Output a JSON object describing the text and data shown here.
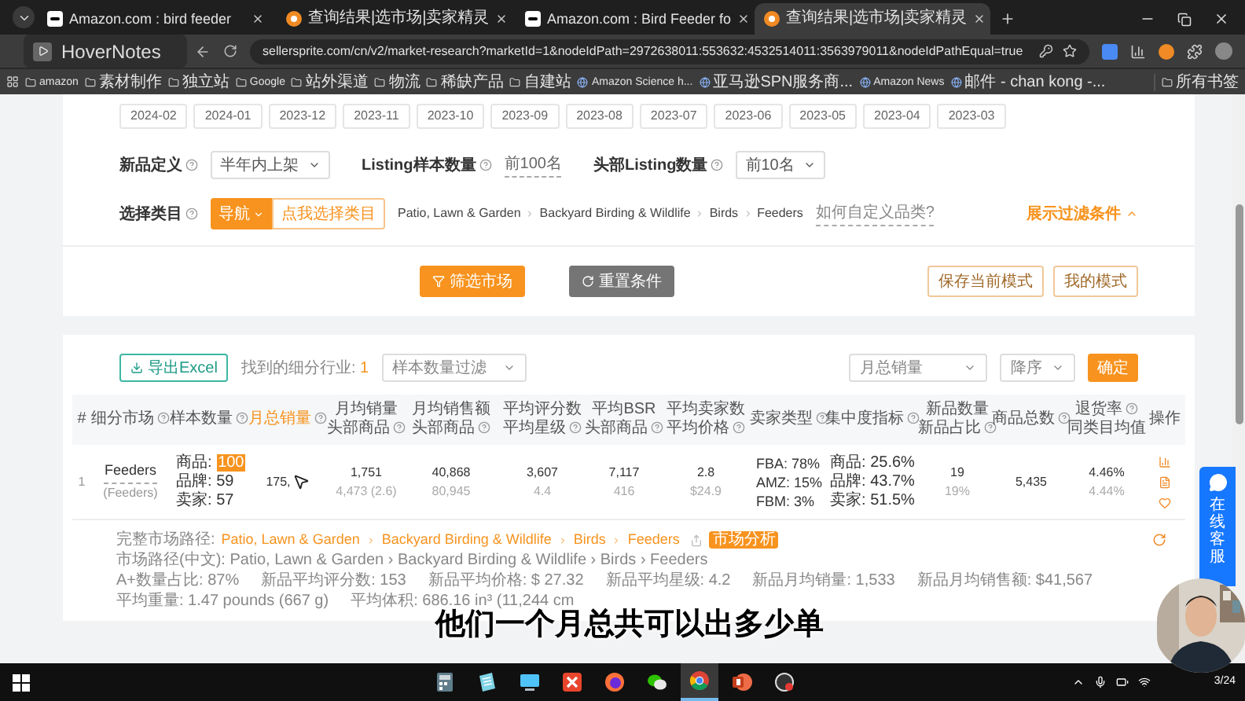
{
  "browser": {
    "tabs": [
      {
        "title": "Amazon.com : bird feeder",
        "kind": "amazon",
        "selected": false
      },
      {
        "title": "查询结果|选市场|卖家精灵",
        "kind": "sprite",
        "selected": false
      },
      {
        "title": "Amazon.com : Bird Feeder fo",
        "kind": "amazon",
        "selected": false
      },
      {
        "title": "查询结果|选市场|卖家精灵",
        "kind": "sprite",
        "selected": true
      }
    ],
    "url": "sellersprite.com/cn/v2/market-research?marketId=1&nodeIdPath=2972638011:553632:4532514011:3563979011&nodeIdPathEqual=true",
    "bookmarks": [
      {
        "label": "amazon",
        "kind": "folder"
      },
      {
        "label": "素材制作",
        "kind": "folder"
      },
      {
        "label": "独立站",
        "kind": "folder"
      },
      {
        "label": "Google",
        "kind": "folder"
      },
      {
        "label": "站外渠道",
        "kind": "folder"
      },
      {
        "label": "物流",
        "kind": "folder"
      },
      {
        "label": "稀缺产品",
        "kind": "folder"
      },
      {
        "label": "自建站",
        "kind": "folder"
      },
      {
        "label": "Amazon Science h...",
        "kind": "link"
      },
      {
        "label": "亚马逊SPN服务商...",
        "kind": "link"
      },
      {
        "label": "Amazon News",
        "kind": "link"
      },
      {
        "label": "邮件 - chan kong -...",
        "kind": "link"
      }
    ],
    "all_bookmarks": "所有书签"
  },
  "overlay": {
    "title": "HoverNotes"
  },
  "filters": {
    "months": [
      {
        "label": "2024-02",
        "selected": false
      },
      {
        "label": "2024-01",
        "selected": false
      },
      {
        "label": "2023-12",
        "selected": false
      },
      {
        "label": "2023-11",
        "selected": false
      },
      {
        "label": "2023-10",
        "selected": false
      },
      {
        "label": "2023-09",
        "selected": false
      },
      {
        "label": "2023-08",
        "selected": false
      },
      {
        "label": "2023-07",
        "selected": false
      },
      {
        "label": "2023-06",
        "selected": false
      },
      {
        "label": "2023-05",
        "selected": false
      },
      {
        "label": "2023-04",
        "selected": false
      },
      {
        "label": "2023-03",
        "selected": false
      }
    ],
    "new_product": {
      "label": "新品定义",
      "value": "半年内上架"
    },
    "sample": {
      "label": "Listing样本数量",
      "value": "前100名"
    },
    "top": {
      "label": "头部Listing数量",
      "value": "前10名"
    },
    "category": {
      "label": "选择类目",
      "nav_button": "导航",
      "pick_button": "点我选择类目",
      "path": [
        "Patio, Lawn & Garden",
        "Backyard Birding & Wildlife",
        "Birds",
        "Feeders"
      ],
      "help_link": "如何自定义品类?"
    },
    "toggle": "展示过滤条件"
  },
  "actions": {
    "filter": "筛选市场",
    "reset": "重置条件",
    "save": "保存当前模式",
    "mine": "我的模式"
  },
  "results": {
    "export": "导出Excel",
    "found_label": "找到的细分行业:",
    "found_count": "1",
    "sample_filter": "样本数量过滤",
    "sort_field": "月总销量",
    "sort_order": "降序",
    "confirm": "确定",
    "columns": [
      {
        "lines": [
          {
            "text": "#",
            "help": false
          }
        ],
        "selected": false
      },
      {
        "lines": [
          {
            "text": "细分市场",
            "help": true
          }
        ],
        "selected": false
      },
      {
        "lines": [
          {
            "text": "样本数量",
            "help": true
          }
        ],
        "selected": false
      },
      {
        "lines": [
          {
            "text": "月总销量",
            "help": true
          }
        ],
        "selected": true
      },
      {
        "lines": [
          {
            "text": "月均销量",
            "help": false
          },
          {
            "text": "头部商品",
            "help": true
          }
        ],
        "selected": false
      },
      {
        "lines": [
          {
            "text": "月均销售额",
            "help": false
          },
          {
            "text": "头部商品",
            "help": true
          }
        ],
        "selected": false
      },
      {
        "lines": [
          {
            "text": "平均评分数",
            "help": false
          },
          {
            "text": "平均星级",
            "help": true
          }
        ],
        "selected": false
      },
      {
        "lines": [
          {
            "text": "平均BSR",
            "help": false
          },
          {
            "text": "头部商品",
            "help": true
          }
        ],
        "selected": false
      },
      {
        "lines": [
          {
            "text": "平均卖家数",
            "help": false
          },
          {
            "text": "平均价格",
            "help": true
          }
        ],
        "selected": false
      },
      {
        "lines": [
          {
            "text": "卖家类型",
            "help": true
          }
        ],
        "selected": false
      },
      {
        "lines": [
          {
            "text": "集中度指标",
            "help": true
          }
        ],
        "selected": false
      },
      {
        "lines": [
          {
            "text": "新品数量",
            "help": false
          },
          {
            "text": "新品占比",
            "help": true
          }
        ],
        "selected": false
      },
      {
        "lines": [
          {
            "text": "商品总数",
            "help": true
          }
        ],
        "selected": false
      },
      {
        "lines": [
          {
            "text": "退货率",
            "help": true
          },
          {
            "text": "同类目均值",
            "help": false
          }
        ],
        "selected": false
      },
      {
        "lines": [
          {
            "text": "操作",
            "help": false
          }
        ],
        "selected": false
      }
    ],
    "rows": [
      {
        "cells": [
          {
            "kind": "index",
            "main": "1"
          },
          {
            "kind": "name",
            "main": "Feeders",
            "sub": "(Feeders)"
          },
          {
            "kind": "sample",
            "items": [
              {
                "label": "商品:",
                "value": "100",
                "highlight": true
              },
              {
                "label": "品牌:",
                "value": "59",
                "highlight": false
              },
              {
                "label": "卖家:",
                "value": "57",
                "highlight": false
              }
            ]
          },
          {
            "kind": "sales",
            "main": "175,"
          },
          {
            "kind": "pair",
            "main": "1,751",
            "sub": "4,473 (2.6)"
          },
          {
            "kind": "pair",
            "main": "40,868",
            "sub": "80,945"
          },
          {
            "kind": "pair",
            "main": "3,607",
            "sub": "4.4"
          },
          {
            "kind": "pair",
            "main": "7,117",
            "sub": "416"
          },
          {
            "kind": "pair",
            "main": "2.8",
            "sub": "$24.9"
          },
          {
            "kind": "list",
            "items": [
              "FBA: 78%",
              "AMZ: 15%",
              "FBM: 3%"
            ]
          },
          {
            "kind": "list",
            "items": [
              "商品: 25.6%",
              "品牌: 43.7%",
              "卖家: 51.5%"
            ]
          },
          {
            "kind": "pair",
            "main": "19",
            "sub": "19%"
          },
          {
            "kind": "single",
            "main": "5,435"
          },
          {
            "kind": "pair",
            "main": "4.46%",
            "sub": "4.44%"
          },
          {
            "kind": "actions"
          }
        ]
      }
    ],
    "details": {
      "full_path_label": "完整市场路径:",
      "full_path": [
        "Patio, Lawn & Garden",
        "Backyard Birding & Wildlife",
        "Birds",
        "Feeders"
      ],
      "badge": "市场分析",
      "cn_path_label": "市场路径(中文):",
      "cn_path": "Patio, Lawn & Garden › Backyard Birding & Wildlife › Birds › Feeders",
      "stats": [
        [
          "A+数量占比: 87%",
          "新品平均评分数: 153",
          "新品平均价格: $ 27.32",
          "新品平均星级: 4.2",
          "新品月均销量: 1,533",
          "新品月均销售额: $41,567"
        ],
        [
          "平均重量: 1.47 pounds (667 g)",
          "平均体积: 686.16 in³ (11,244 cm"
        ]
      ]
    }
  },
  "chat_widget": {
    "label": "在线客服"
  },
  "subtitle": "他们一个月总共可以出多少单",
  "taskbar": {
    "apps": [
      {
        "kind": "calculator",
        "selected": false
      },
      {
        "kind": "notepad",
        "selected": false
      },
      {
        "kind": "computer",
        "selected": false
      },
      {
        "kind": "xmind",
        "selected": false
      },
      {
        "kind": "firefox",
        "selected": false
      },
      {
        "kind": "wechat",
        "selected": false
      },
      {
        "kind": "chrome",
        "selected": true
      },
      {
        "kind": "powerpoint",
        "selected": false
      },
      {
        "kind": "recorder",
        "selected": false
      }
    ],
    "clock": "3/24"
  }
}
